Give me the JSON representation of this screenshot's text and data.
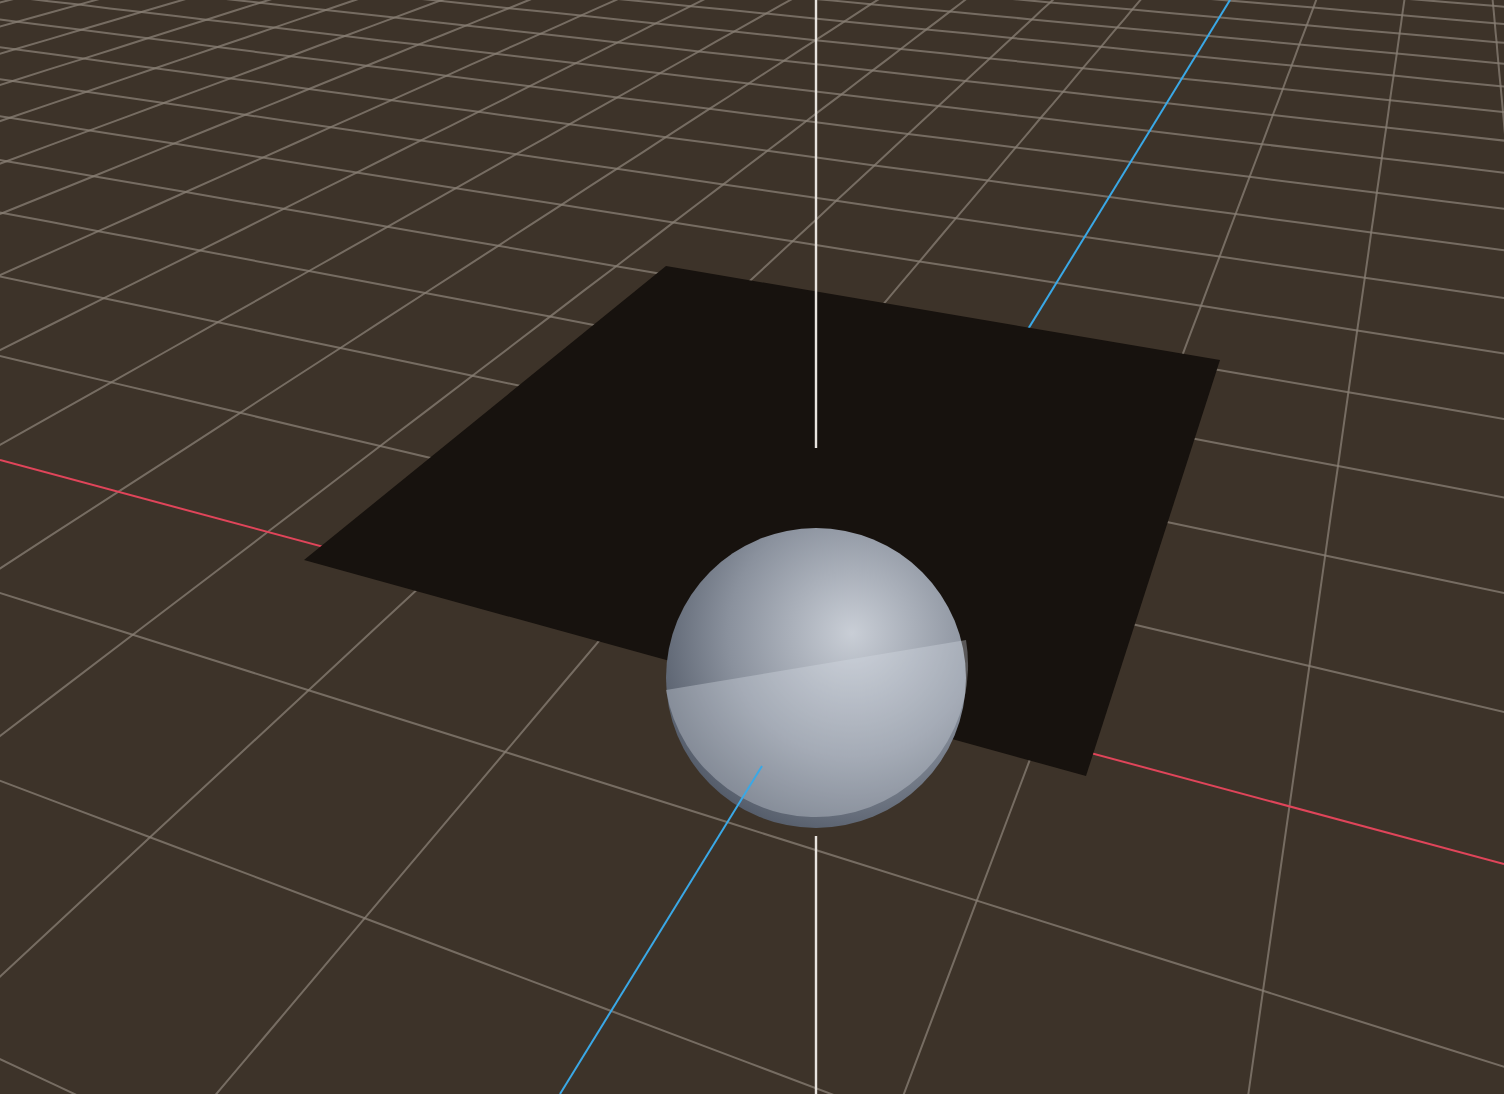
{
  "viewport": {
    "objects": [
      {
        "kind": "plane"
      },
      {
        "kind": "sphere"
      }
    ]
  }
}
